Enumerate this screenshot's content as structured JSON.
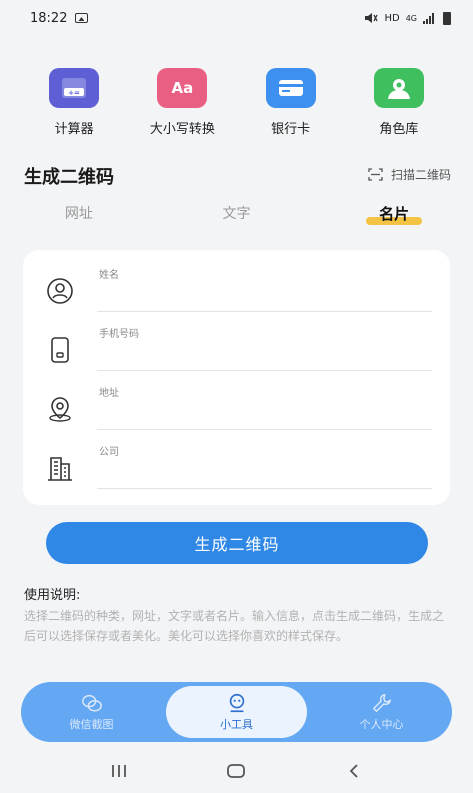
{
  "status_bar": {
    "time": "18:22",
    "network": "HD",
    "network_type": "4G"
  },
  "tools": [
    {
      "label": "计算器",
      "icon": "calculator-icon",
      "color": "#5e5fd4"
    },
    {
      "label": "大小写转换",
      "icon": "case-convert-icon",
      "glyph": "Aa",
      "color": "#e95f83"
    },
    {
      "label": "银行卡",
      "icon": "bank-card-icon",
      "color": "#3d8ff0"
    },
    {
      "label": "角色库",
      "icon": "character-library-icon",
      "color": "#3fbf5e"
    }
  ],
  "section": {
    "title": "生成二维码",
    "scan_label": "扫描二维码"
  },
  "tabs": [
    {
      "label": "网址",
      "active": false
    },
    {
      "label": "文字",
      "active": false
    },
    {
      "label": "名片",
      "active": true
    }
  ],
  "form": {
    "fields": [
      {
        "label": "姓名",
        "icon": "person-icon",
        "value": ""
      },
      {
        "label": "手机号码",
        "icon": "phone-icon",
        "value": ""
      },
      {
        "label": "地址",
        "icon": "location-icon",
        "value": ""
      },
      {
        "label": "公司",
        "icon": "building-icon",
        "value": ""
      }
    ]
  },
  "generate_button": "生成二维码",
  "instructions": {
    "title": "使用说明:",
    "body": "选择二维码的种类，网址，文字或者名片。输入信息，点击生成二维码，生成之后可以选择保存或者美化。美化可以选择你喜欢的样式保存。"
  },
  "bottom_nav": [
    {
      "label": "微信截图",
      "icon": "chat-icon",
      "active": false
    },
    {
      "label": "小工具",
      "icon": "robot-icon",
      "active": true
    },
    {
      "label": "个人中心",
      "icon": "wrench-icon",
      "active": false
    }
  ],
  "colors": {
    "accent": "#2f87e6",
    "tab_highlight": "#f5c343",
    "nav_bg": "#64a7f2"
  }
}
